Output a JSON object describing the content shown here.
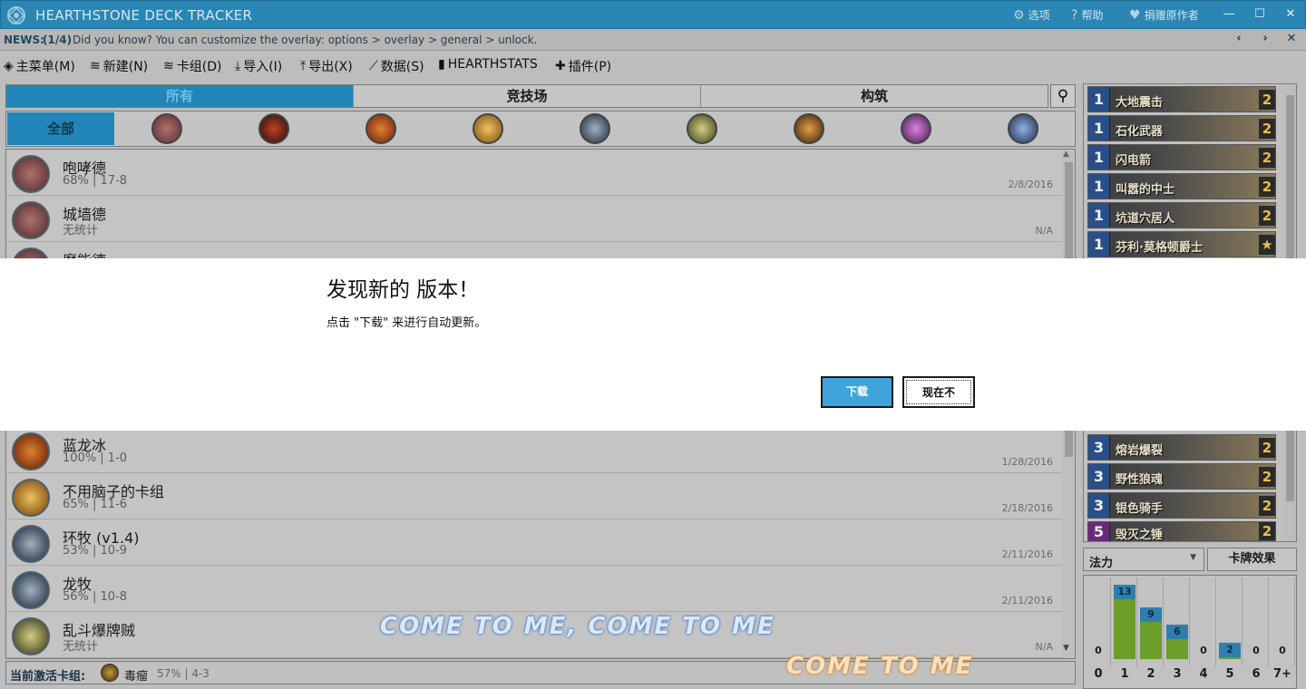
{
  "window": {
    "title": "HEARTHSTONE DECK TRACKER",
    "options_label": "选项",
    "help_label": "帮助",
    "donate_label": "捐赠原作者"
  },
  "news": {
    "label": "NEWS:",
    "count": "(1/4)",
    "text": "Did you know? You can customize the overlay: options > overlay > general > unlock."
  },
  "menu": {
    "main": "主菜单(M)",
    "new": "新建(N)",
    "decks": "卡组(D)",
    "import": "导入(I)",
    "export": "导出(X)",
    "stats": "数据(S)",
    "hearthstats": "HEARTHSTATS",
    "plugins": "插件(P)"
  },
  "tabs": [
    "所有",
    "竞技场",
    "构筑"
  ],
  "class_filter": {
    "all": "全部"
  },
  "decks": [
    {
      "name": "咆哮德",
      "stat": "68% | 17-8",
      "date": "2/8/2016"
    },
    {
      "name": "城墙德",
      "stat": "无统计",
      "date": "N/A"
    },
    {
      "name": "魔能德",
      "stat": "",
      "date": ""
    },
    {
      "name": "蓝龙冰",
      "stat": "100% | 1-0",
      "date": "1/28/2016"
    },
    {
      "name": "不用脑子的卡组",
      "stat": "65% | 11-6",
      "date": "2/18/2016"
    },
    {
      "name": "环牧 (v1.4)",
      "stat": "53% | 10-9",
      "date": "2/11/2016"
    },
    {
      "name": "龙牧",
      "stat": "56% | 10-8",
      "date": "2/11/2016"
    },
    {
      "name": "乱斗爆牌贼",
      "stat": "无统计",
      "date": "N/A"
    }
  ],
  "footer": {
    "label": "当前激活卡组:",
    "deck_name": "毒瘤",
    "deck_stat": "57% | 4-3"
  },
  "cards": [
    {
      "cost": "1",
      "name": "大地震击",
      "count": "2"
    },
    {
      "cost": "1",
      "name": "石化武器",
      "count": "2"
    },
    {
      "cost": "1",
      "name": "闪电箭",
      "count": "2"
    },
    {
      "cost": "1",
      "name": "叫嚣的中士",
      "count": "2"
    },
    {
      "cost": "1",
      "name": "坑道穴居人",
      "count": "2"
    },
    {
      "cost": "1",
      "name": "芬利·莫格顿爵士",
      "count": "★"
    },
    {
      "cost": "3",
      "name": "熔岩爆裂",
      "count": "2"
    },
    {
      "cost": "3",
      "name": "野性狼魂",
      "count": "2"
    },
    {
      "cost": "3",
      "name": "银色骑手",
      "count": "2"
    },
    {
      "cost": "5",
      "name": "毁灭之锤",
      "count": "2"
    }
  ],
  "mana_select": "法力",
  "effects_button": "卡牌效果",
  "curve": {
    "labels": [
      "0",
      "1",
      "2",
      "3",
      "4",
      "5",
      "6",
      "7+"
    ],
    "values": [
      0,
      13,
      9,
      6,
      0,
      2,
      0,
      0
    ]
  },
  "overlay_text": {
    "line1": "COME TO ME, COME TO ME",
    "line2": "COME TO ME"
  },
  "dialog": {
    "title": "发现新的 版本！",
    "message": "点击 \"下载\" 来进行自动更新。",
    "download": "下载",
    "not_now": "现在不"
  },
  "colors": {
    "accent": "#2186b7",
    "button_blue": "#3fa4db"
  }
}
